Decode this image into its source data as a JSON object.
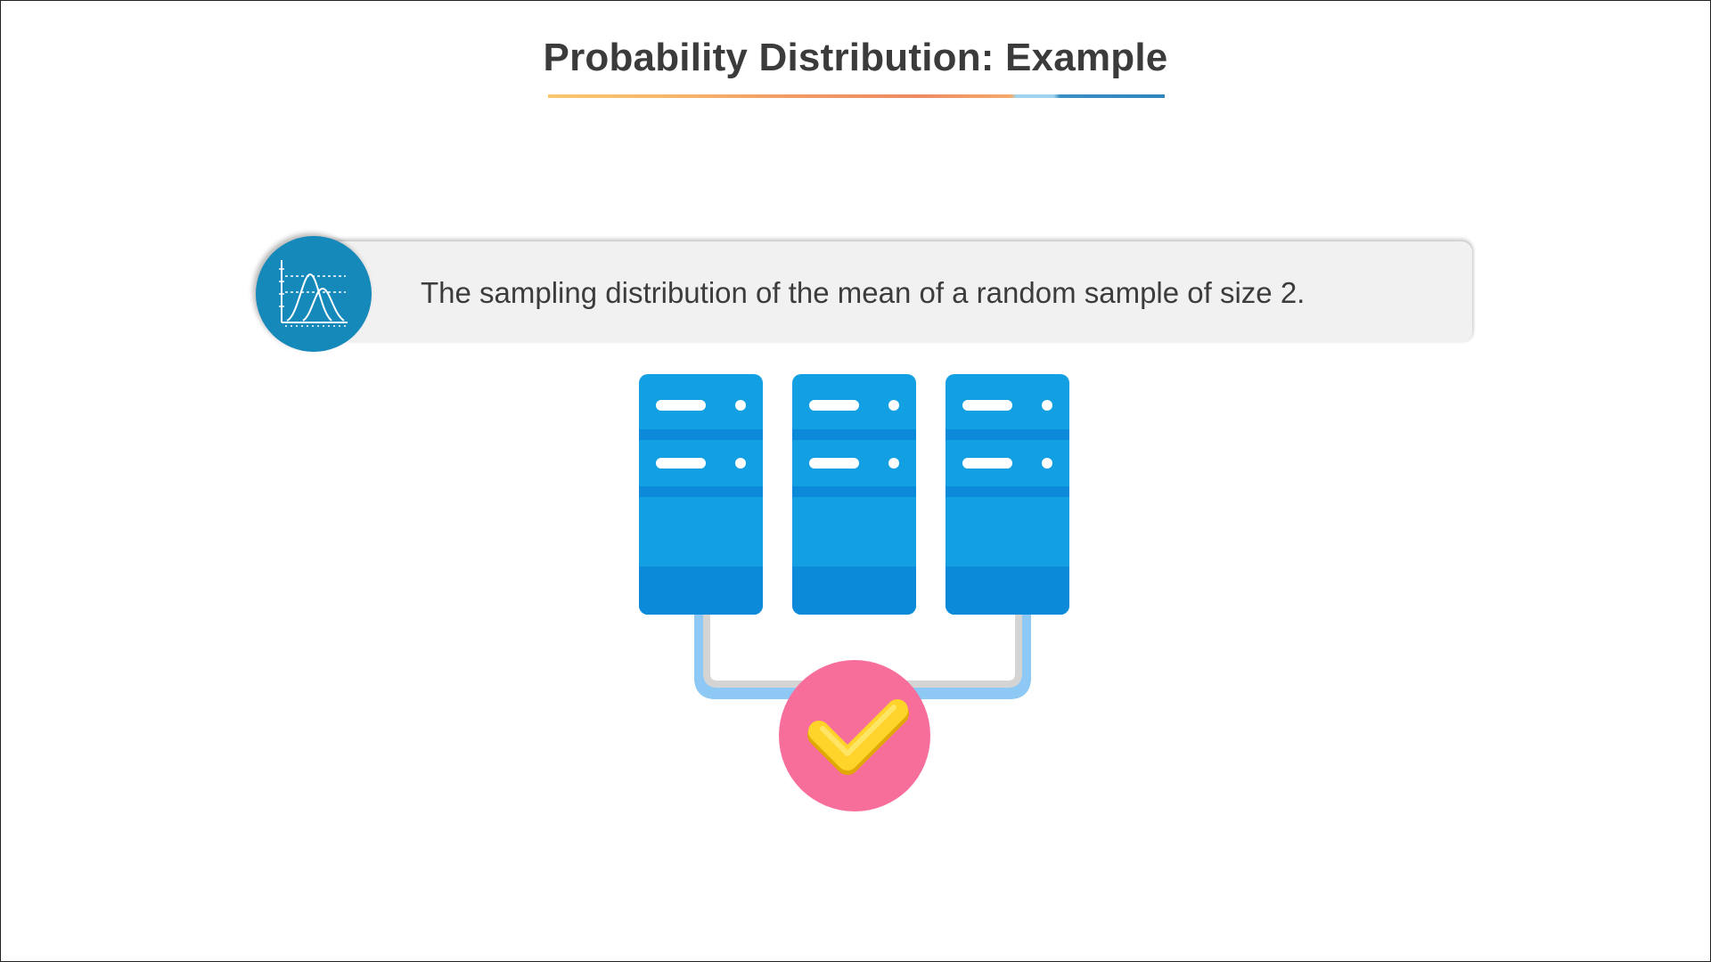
{
  "slide": {
    "title": "Probability Distribution: Example",
    "statement": "The sampling distribution of the mean of a random sample of size 2."
  },
  "icons": {
    "badge": "distribution-curve-icon",
    "illustration": "server-racks-check-icon",
    "check": "checkmark-icon"
  },
  "colors": {
    "title_text": "#3b3b3b",
    "badge": "#1689bb",
    "server_blue": "#12a0e3",
    "server_dark": "#0a8ad8",
    "check_circle": "#f76e9b",
    "check_mark": "#ffd42a",
    "connector_blue": "#8ec8f5",
    "connector_gray": "#d4d4d4"
  }
}
